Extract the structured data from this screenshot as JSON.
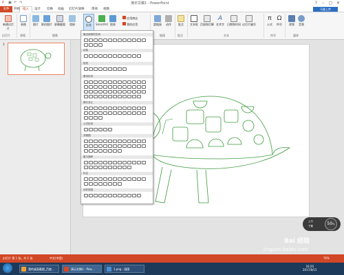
{
  "titlebar": {
    "title": "演示文稿1 - PowerPoint",
    "help": "?",
    "minimize": "–",
    "restore": "▢",
    "close": "✕"
  },
  "tabs": {
    "file": "文件",
    "items": [
      "开始",
      "插入",
      "设计",
      "切换",
      "动画",
      "幻灯片放映",
      "审阅",
      "视图"
    ],
    "login": "马维上传"
  },
  "ribbon": {
    "new_slide": "新建幻灯片",
    "table": "表格",
    "picture": "图片",
    "online_picture": "联机图片",
    "screenshot": "屏幕截图",
    "album": "相册",
    "shapes": "形状",
    "smartart": "SmartArt",
    "chart": "图表",
    "apps_store": "应用商店",
    "my_apps": "我的应用",
    "hyperlink": "超链接",
    "action": "动作",
    "comment": "批注",
    "textbox": "文本框",
    "header_footer": "页眉和页脚",
    "wordart": "艺术字",
    "date_time": "日期和时间",
    "slide_number": "幻灯片编号",
    "equation": "公式",
    "symbol": "符号",
    "video": "视频",
    "audio": "音频",
    "groups": {
      "slides": "幻灯片",
      "tables": "表格",
      "images": "图像",
      "links": "链接",
      "comments": "批注",
      "text": "文本",
      "symbols": "符号",
      "media": "媒体"
    }
  },
  "dropdown": {
    "sections": [
      "最近使用的形状",
      "线条",
      "矩形",
      "基本形状",
      "箭头总汇",
      "公式形状",
      "流程图",
      "星与旗帜",
      "标注",
      "动作按钮"
    ]
  },
  "slidepanel": {
    "slide_number": "1"
  },
  "statusbar": {
    "slide_info": "幻灯片 第 1 张，共 1 张",
    "language": "中文(中国)",
    "zoom": "76%"
  },
  "taskbar": {
    "tasks": [
      "我的桌面截图_百度...",
      "演示文稿1 - Pow...",
      "1.png - 画图"
    ],
    "time": "16:20",
    "date": "2017/8/15"
  },
  "zoom_badge": {
    "value": "50",
    "unit": "%",
    "label1": "上行",
    "label2": "下载"
  },
  "watermark": {
    "text": "Bai 经验",
    "url": "jingyan.baidu.com"
  },
  "colors": {
    "accent": "#d24726",
    "turtle": "#3a9a3a",
    "thumb_border": "#e8845f"
  }
}
